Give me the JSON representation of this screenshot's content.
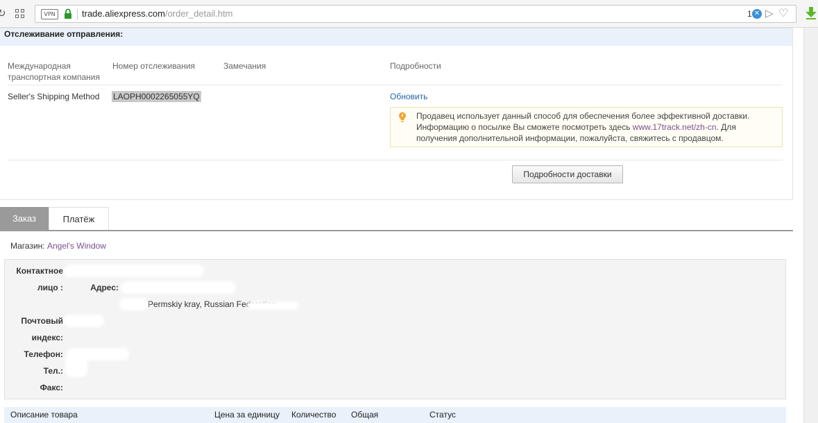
{
  "browser": {
    "vpn_label": "VPN",
    "url_host": "trade.aliexpress.com",
    "url_path": "/order_detail.htm",
    "ext_count": "1"
  },
  "tracking": {
    "title": "Отслеживание отправления:",
    "headers": {
      "company": "Международная транспортная компания",
      "number": "Номер отслеживания",
      "notes": "Замечания",
      "details": "Подробности"
    },
    "row": {
      "company": "Seller's Shipping Method",
      "number": "LAOPH0002265055YQ",
      "update_link": "Обновить"
    },
    "notice": {
      "text_before": "Продавец использует данный способ для обеспечения более эффективной доставки. Информацию о посылке Вы сможете посмотреть здесь ",
      "link": "www.17track.net/zh-cn",
      "text_after": ". Для получения дополнительной информации, пожалуйста, свяжитесь с продавцом."
    },
    "delivery_button": "Подробности доставки"
  },
  "tabs": {
    "order": "Заказ",
    "payment": "Платёж"
  },
  "shop": {
    "label": "Магазин:",
    "name": "Angel's Window"
  },
  "contact": {
    "contact_label_1": "Контактное",
    "contact_label_2": "лицо :",
    "address_label": "Адрес:",
    "address_fragment": "Permskiy kray, Russian Federation",
    "postal_label_1": "Почтовый",
    "postal_label_2": "индекс:",
    "phone_label": "Телефон:",
    "tel_label": "Тел.:",
    "fax_label": "Факс:"
  },
  "products_header": {
    "description": "Описание товара",
    "unit_price": "Цена за единицу",
    "quantity": "Количество",
    "total": "Общая",
    "status": "Статус"
  },
  "colors": {
    "link_blue": "#2563a8",
    "link_purple": "#7a4f8f",
    "notice_bg": "#fffdf5",
    "tab_active_bg": "#9a9a9a",
    "header_bg": "#eaf1fb"
  }
}
